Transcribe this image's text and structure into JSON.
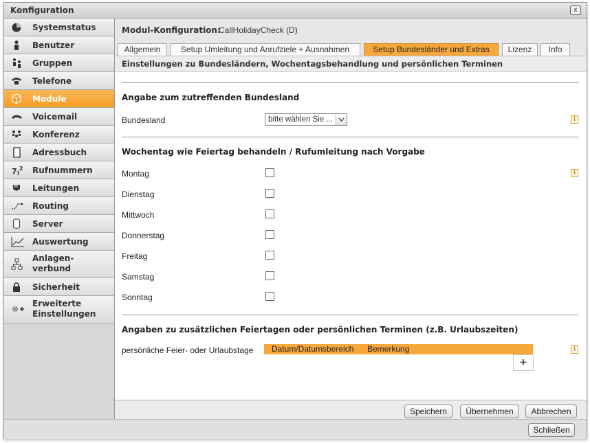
{
  "window": {
    "title": "Konfiguration",
    "close_label": "x"
  },
  "sidebar": {
    "items": [
      {
        "label": "Systemstatus",
        "icon": "pie-chart-icon"
      },
      {
        "label": "Benutzer",
        "icon": "user-icon"
      },
      {
        "label": "Gruppen",
        "icon": "group-icon"
      },
      {
        "label": "Telefone",
        "icon": "phone-icon"
      },
      {
        "label": "Module",
        "icon": "cube-icon",
        "active": true
      },
      {
        "label": "Voicemail",
        "icon": "voicemail-icon"
      },
      {
        "label": "Konferenz",
        "icon": "conference-icon"
      },
      {
        "label": "Adressbuch",
        "icon": "address-book-icon"
      },
      {
        "label": "Rufnummern",
        "icon": "numbers-icon"
      },
      {
        "label": "Leitungen",
        "icon": "lines-icon"
      },
      {
        "label": "Routing",
        "icon": "routing-icon"
      },
      {
        "label": "Server",
        "icon": "server-icon"
      },
      {
        "label": "Auswertung",
        "icon": "chart-icon"
      },
      {
        "label": "Anlagen-\nverbund",
        "icon": "network-icon"
      },
      {
        "label": "Sicherheit",
        "icon": "lock-icon"
      },
      {
        "label": "Erweiterte\nEinstellungen",
        "icon": "gear-plus-icon"
      }
    ]
  },
  "module": {
    "header_label": "Modul-Konfiguration:",
    "header_value": "CallHolidayCheck (D)"
  },
  "tabs": [
    {
      "label": "Allgemein"
    },
    {
      "label": "Setup Umleitung und Anrufziele + Ausnahmen"
    },
    {
      "label": "Setup Bundesländer und Extras",
      "active": true
    },
    {
      "label": "Lizenz"
    },
    {
      "label": "Info"
    }
  ],
  "subheader": "Einstellungen zu Bundesländern, Wochentagsbehandlung und persönlichen Terminen",
  "section1": {
    "title": "Angabe zum zutreffenden Bundesland",
    "field_label": "Bundesland",
    "select_value": "bitte wählen Sie ..."
  },
  "section2": {
    "title": "Wochentag wie Feiertag behandeln / Rufumleitung nach Vorgabe",
    "days": [
      "Montag",
      "Dienstag",
      "Mittwoch",
      "Donnerstag",
      "Freitag",
      "Samstag",
      "Sonntag"
    ]
  },
  "section3": {
    "title": "Angaben zu zusätzlichen Feiertagen oder persönlichen Terminen (z.B. Urlaubszeiten)",
    "field_label": "persönliche Feier- oder Urlaubstage",
    "columns": [
      "Datum/Datumsbereich",
      "Bemerkung"
    ],
    "add_label": "+"
  },
  "info_label": "i",
  "buttons": {
    "save": "Speichern",
    "apply": "Übernehmen",
    "cancel": "Abbrechen",
    "close": "Schließen"
  },
  "colors": {
    "accent": "#f7a83c",
    "sidebar_bg": "#d7d7d7"
  }
}
